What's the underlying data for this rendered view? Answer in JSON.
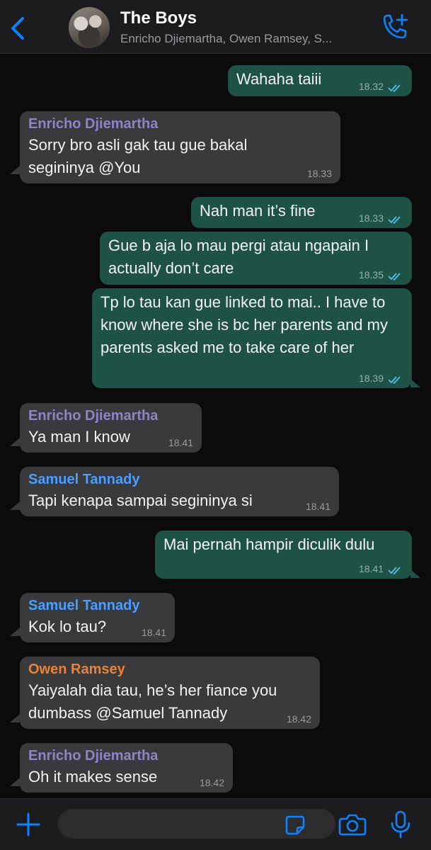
{
  "header": {
    "title": "The Boys",
    "members": "Enricho Djiemartha, Owen Ramsey, S..."
  },
  "colors": {
    "outgoing_bubble": "#1f5246",
    "incoming_bubble": "#3a3a3c",
    "accent": "#0a84ff",
    "sender_enricho": "#8e83c9",
    "sender_samuel": "#4a9eff",
    "sender_owen": "#e8823a"
  },
  "messages": [
    {
      "direction": "out",
      "text": "Wahaha taiii",
      "time": "18.32",
      "read": true
    },
    {
      "direction": "in",
      "sender": "Enricho Djiemartha",
      "text": "Sorry bro asli gak tau gue bakal segininya @You",
      "time": "18.33"
    },
    {
      "direction": "out",
      "text": "Nah man it’s fine",
      "time": "18.33",
      "read": true
    },
    {
      "direction": "out",
      "text": "Gue b aja lo mau pergi atau ngapain I actually don’t care",
      "time": "18.35",
      "read": true
    },
    {
      "direction": "out",
      "text": "Tp lo tau kan gue linked to mai.. I have to know where she is bc her parents and my parents asked me to take care of her",
      "time": "18.39",
      "read": true
    },
    {
      "direction": "in",
      "sender": "Enricho Djiemartha",
      "text": "Ya man I know",
      "time": "18.41"
    },
    {
      "direction": "in",
      "sender": "Samuel Tannady",
      "text": "Tapi kenapa sampai segininya si",
      "time": "18.41"
    },
    {
      "direction": "out",
      "text": "Mai pernah hampir diculik dulu",
      "time": "18.41",
      "read": true
    },
    {
      "direction": "in",
      "sender": "Samuel Tannady",
      "text": "Kok lo tau?",
      "time": "18.41"
    },
    {
      "direction": "in",
      "sender": "Owen Ramsey",
      "text": "Yaiyalah dia tau, he’s her fiance you dumbass @Samuel Tannady",
      "time": "18.42"
    },
    {
      "direction": "in",
      "sender": "Enricho Djiemartha",
      "text": "Oh it makes sense",
      "time": "18.42"
    }
  ],
  "composer": {
    "value": "",
    "placeholder": ""
  },
  "icons": [
    "chevron-left-icon",
    "add-call-icon",
    "plus-icon",
    "sticker-icon",
    "camera-icon",
    "microphone-icon",
    "double-check-icon"
  ]
}
